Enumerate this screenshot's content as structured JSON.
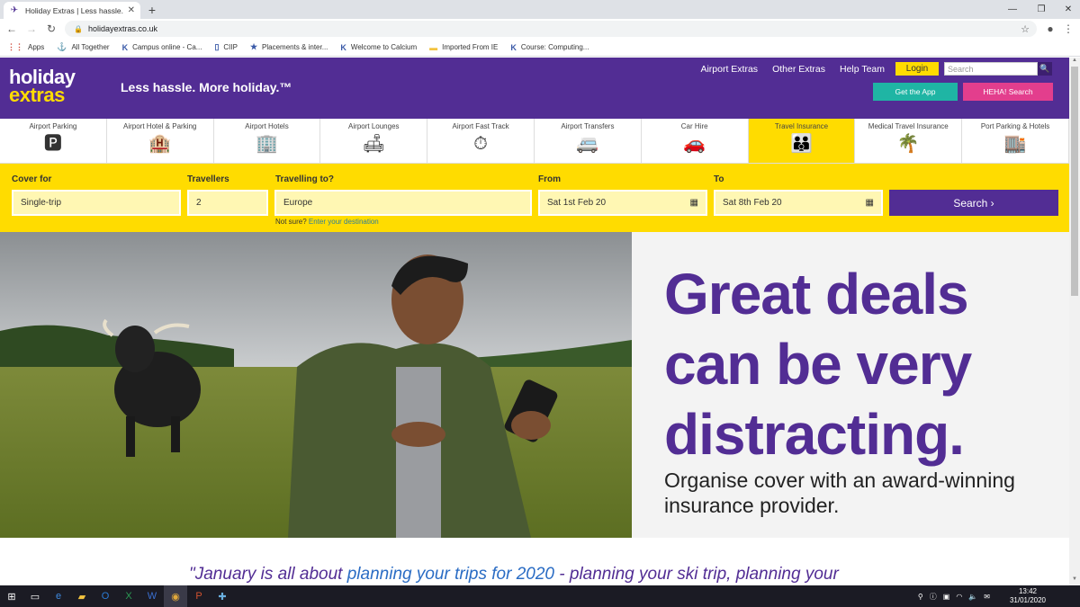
{
  "browser": {
    "tab_title": "Holiday Extras | Less hassle. More",
    "url": "holidayextras.co.uk",
    "bookmarks": [
      {
        "label": "Apps",
        "icon": "apps-grid-icon"
      },
      {
        "label": "All Together",
        "icon": "bookmark-icon"
      },
      {
        "label": "Campus online - Ca...",
        "icon": "ke-icon"
      },
      {
        "label": "CIIP",
        "icon": "page-icon"
      },
      {
        "label": "Placements & inter...",
        "icon": "star-icon"
      },
      {
        "label": "Welcome to Calcium",
        "icon": "ke-icon"
      },
      {
        "label": "Imported From IE",
        "icon": "folder-icon"
      },
      {
        "label": "Course: Computing...",
        "icon": "ke-icon"
      }
    ]
  },
  "header": {
    "logo_line1": "holiday",
    "logo_line2": "extras",
    "tagline": "Less hassle. More holiday.™",
    "nav": [
      "Airport Extras",
      "Other Extras",
      "Help Team"
    ],
    "login": "Login",
    "search_placeholder": "Search",
    "get_app": "Get the App",
    "heha_search": "HEHA! Search"
  },
  "products": [
    {
      "label": "Airport Parking",
      "icon": "parking-car-icon"
    },
    {
      "label": "Airport Hotel & Parking",
      "icon": "hotel-parking-icon"
    },
    {
      "label": "Airport Hotels",
      "icon": "hotel-building-icon"
    },
    {
      "label": "Airport Lounges",
      "icon": "lounge-icon"
    },
    {
      "label": "Airport Fast Track",
      "icon": "fast-track-icon"
    },
    {
      "label": "Airport Transfers",
      "icon": "transfer-van-icon"
    },
    {
      "label": "Car Hire",
      "icon": "car-icon"
    },
    {
      "label": "Travel Insurance",
      "icon": "family-icon",
      "active": true
    },
    {
      "label": "Medical Travel Insurance",
      "icon": "palm-tree-icon"
    },
    {
      "label": "Port Parking & Hotels",
      "icon": "port-hotel-icon"
    }
  ],
  "form": {
    "cover_label": "Cover for",
    "cover_value": "Single-trip",
    "travellers_label": "Travellers",
    "travellers_value": "2",
    "destination_label": "Travelling to?",
    "destination_value": "Europe",
    "not_sure": "Not sure?",
    "enter_destination": "Enter your destination",
    "from_label": "From",
    "from_value": "Sat 1st Feb 20",
    "to_label": "To",
    "to_value": "Sat 8th Feb 20",
    "search_button": "Search ›"
  },
  "hero": {
    "headline_1": "Great deals",
    "headline_2": "can be very",
    "headline_3": "distracting.",
    "subline_1": "Organise cover with an award-winning",
    "subline_2": "insurance provider."
  },
  "quote": {
    "start": "\"January is all about ",
    "link": "planning your trips for 2020",
    "rest": " - planning your ski trip, planning your"
  },
  "taskbar": {
    "time": "13:42",
    "date": "31/01/2020"
  },
  "colors": {
    "brand_purple": "#522d94",
    "brand_yellow": "#ffdc00",
    "app_teal": "#1fb5a4",
    "heha_pink": "#e33e8d"
  }
}
